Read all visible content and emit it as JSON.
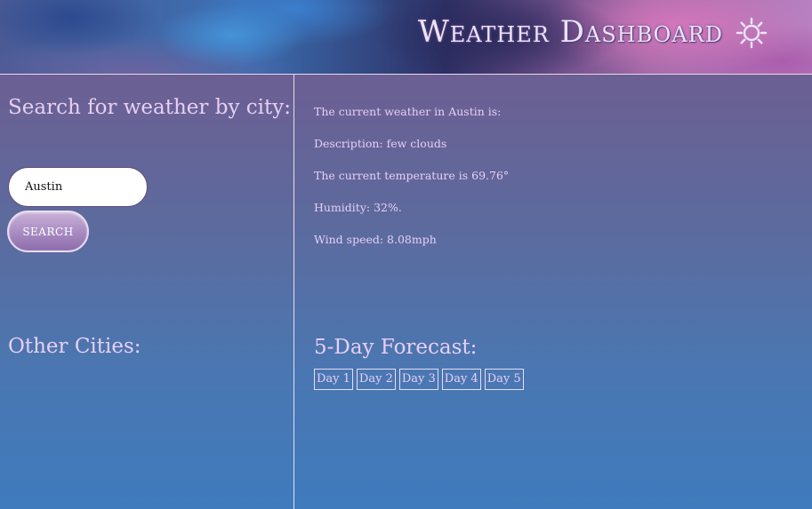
{
  "header": {
    "title": "Weather Dashboard",
    "icon": "sun-icon"
  },
  "search": {
    "heading": "Search for weather by city:",
    "input_value": "Austin",
    "button_label": "SEARCH"
  },
  "other_cities": {
    "heading": "Other Cities:"
  },
  "current": {
    "intro": "The current weather in Austin is:",
    "description": "Description: few clouds",
    "temperature": "The current temperature is 69.76°",
    "humidity": "Humidity: 32%.",
    "wind": "Wind speed: 8.08mph"
  },
  "forecast": {
    "heading": "5-Day Forecast:",
    "days": [
      "Day 1",
      "Day 2",
      "Day 3",
      "Day 4",
      "Day 5"
    ]
  },
  "colors": {
    "text": "#e7cff4",
    "border": "#e8dcf1",
    "button": "#a88ac1"
  }
}
